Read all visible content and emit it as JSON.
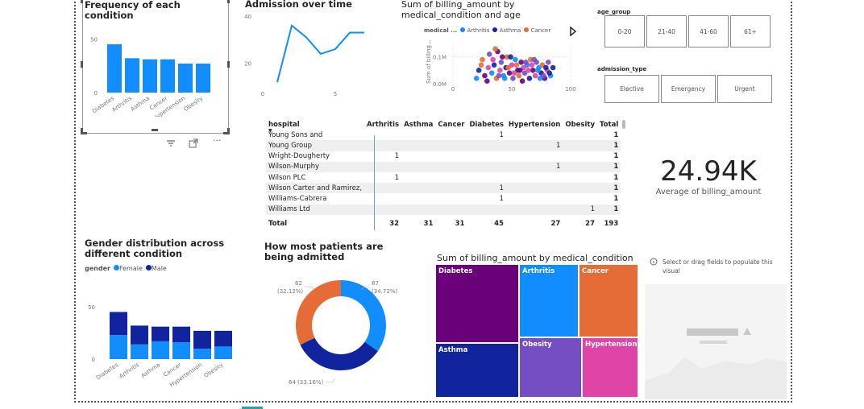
{
  "freq_chart": {
    "title": "Frequency of each condition",
    "chart_data": {
      "type": "bar",
      "categories": [
        "Diabetes",
        "Arthritis",
        "Asthma",
        "Cancer",
        "Hypertension",
        "Obesity"
      ],
      "values": [
        45,
        32,
        31,
        31,
        27,
        27
      ],
      "ylim": [
        0,
        60
      ],
      "yticks": [
        "0",
        "50"
      ],
      "color": "#118DFF"
    },
    "toolbar": {
      "filter_icon": "filter-icon",
      "focus_icon": "focus-mode-icon",
      "more_icon": "more-options-icon"
    }
  },
  "admission_chart": {
    "title": "Admission over time",
    "chart_data": {
      "type": "line",
      "x": [
        1,
        2,
        3,
        4,
        5,
        6,
        7
      ],
      "y": [
        12,
        36,
        31,
        24,
        26,
        33,
        33
      ],
      "xlim": [
        0,
        8
      ],
      "ylim": [
        10,
        40
      ],
      "xticks": [
        "0",
        "5"
      ],
      "yticks": [
        "20",
        "40"
      ],
      "color": "#118DFF"
    }
  },
  "scatter_chart": {
    "title": "Sum of billing_amount by medical_condition and age",
    "legend_label": "medical ...",
    "legend": [
      {
        "name": "Arthritis",
        "color": "#118DFF"
      },
      {
        "name": "Asthma",
        "color": "#12239E"
      },
      {
        "name": "Cancer",
        "color": "#E66C37"
      }
    ],
    "ylabel": "Sum of billing...",
    "yticks": [
      "0.0M",
      "0.1M"
    ],
    "xticks": [
      "0",
      "50",
      "100"
    ],
    "chart_data": {
      "type": "scatter",
      "xlim": [
        0,
        100
      ],
      "ylim": [
        0,
        0.15
      ],
      "series_colors": [
        "#118DFF",
        "#12239E",
        "#E66C37",
        "#6B007B",
        "#E044A7",
        "#744EC2"
      ],
      "points": [
        [
          20,
          0.02
        ],
        [
          22,
          0.05
        ],
        [
          25,
          0.09
        ],
        [
          27,
          0.03
        ],
        [
          30,
          0.06
        ],
        [
          31,
          0.11
        ],
        [
          33,
          0.04
        ],
        [
          35,
          0.07
        ],
        [
          37,
          0.02
        ],
        [
          38,
          0.12
        ],
        [
          40,
          0.05
        ],
        [
          41,
          0.08
        ],
        [
          43,
          0.03
        ],
        [
          45,
          0.06
        ],
        [
          46,
          0.1
        ],
        [
          48,
          0.04
        ],
        [
          50,
          0.07
        ],
        [
          51,
          0.02
        ],
        [
          53,
          0.09
        ],
        [
          55,
          0.05
        ],
        [
          56,
          0.03
        ],
        [
          58,
          0.08
        ],
        [
          60,
          0.06
        ],
        [
          61,
          0.04
        ],
        [
          63,
          0.07
        ],
        [
          65,
          0.02
        ],
        [
          66,
          0.09
        ],
        [
          68,
          0.05
        ],
        [
          70,
          0.03
        ],
        [
          71,
          0.08
        ],
        [
          73,
          0.06
        ],
        [
          75,
          0.04
        ],
        [
          76,
          0.07
        ],
        [
          78,
          0.02
        ],
        [
          80,
          0.05
        ],
        [
          81,
          0.08
        ],
        [
          83,
          0.03
        ],
        [
          85,
          0.06
        ],
        [
          24,
          0.07
        ],
        [
          29,
          0.01
        ],
        [
          34,
          0.09
        ],
        [
          39,
          0.03
        ],
        [
          44,
          0.02
        ],
        [
          49,
          0.1
        ],
        [
          54,
          0.07
        ],
        [
          59,
          0.01
        ],
        [
          64,
          0.05
        ],
        [
          69,
          0.09
        ],
        [
          74,
          0.02
        ],
        [
          79,
          0.06
        ],
        [
          36,
          0.13
        ],
        [
          42,
          0.1
        ],
        [
          52,
          0.04
        ],
        [
          62,
          0.08
        ],
        [
          72,
          0.05
        ],
        [
          82,
          0.04
        ],
        [
          47,
          0.06
        ],
        [
          57,
          0.05
        ],
        [
          67,
          0.07
        ],
        [
          77,
          0.03
        ]
      ]
    },
    "play_icon": "play-icon"
  },
  "slicers": {
    "age_group": {
      "title": "age_group",
      "options": [
        "0-20",
        "21-40",
        "41-60",
        "61+"
      ]
    },
    "admission_type": {
      "title": "admission_type",
      "options": [
        "Elective",
        "Emergency",
        "Urgent"
      ]
    }
  },
  "matrix": {
    "headers": [
      "hospital",
      "Arthritis",
      "Asthma",
      "Cancer",
      "Diabetes",
      "Hypertension",
      "Obesity",
      "Total"
    ],
    "rows": [
      [
        "Young Sons and",
        "",
        "",
        "",
        "1",
        "",
        "",
        "1"
      ],
      [
        "Young Group",
        "",
        "",
        "",
        "",
        "1",
        "",
        "1"
      ],
      [
        "Wright-Dougherty",
        "1",
        "",
        "",
        "",
        "",
        "",
        "1"
      ],
      [
        "Wilson-Murphy",
        "",
        "",
        "",
        "",
        "1",
        "",
        "1"
      ],
      [
        "Wilson PLC",
        "1",
        "",
        "",
        "",
        "",
        "",
        "1"
      ],
      [
        "Wilson Carter and Ramirez,",
        "",
        "",
        "",
        "1",
        "",
        "",
        "1"
      ],
      [
        "Williams-Cabrera",
        "",
        "",
        "",
        "1",
        "",
        "",
        "1"
      ],
      [
        "Williams Ltd",
        "",
        "",
        "",
        "",
        "",
        "1",
        "1"
      ]
    ],
    "total": [
      "Total",
      "32",
      "31",
      "31",
      "45",
      "27",
      "27",
      "193"
    ]
  },
  "card": {
    "value": "24.94K",
    "label": "Average of billing_amount"
  },
  "gender_chart": {
    "title": "Gender distribution across different condition",
    "legend_label": "gender",
    "legend": [
      {
        "name": "Female",
        "color": "#118DFF"
      },
      {
        "name": "Male",
        "color": "#12239E"
      }
    ],
    "chart_data": {
      "type": "bar",
      "stacked": true,
      "categories": [
        "Diabetes",
        "Arthritis",
        "Asthma",
        "Cancer",
        "Hypertension",
        "Obesity"
      ],
      "series": [
        {
          "name": "Female",
          "values": [
            23,
            14,
            17,
            16,
            10,
            12
          ]
        },
        {
          "name": "Male",
          "values": [
            22,
            18,
            14,
            15,
            17,
            15
          ]
        }
      ],
      "ylim": [
        0,
        60
      ],
      "yticks": [
        "0",
        "50"
      ]
    }
  },
  "donut_chart": {
    "title": "How most patients are being admitted",
    "chart_data": {
      "type": "pie",
      "slices": [
        {
          "value": 67,
          "label": "67",
          "pct": "(34.72%)",
          "color": "#118DFF"
        },
        {
          "value": 64,
          "label": "64 (33.16%)",
          "pct": "",
          "color": "#12239E"
        },
        {
          "value": 62,
          "label": "62",
          "pct": "(32.12%)",
          "color": "#E66C37"
        }
      ]
    }
  },
  "treemap": {
    "title": "Sum of billing_amount by medical_condition",
    "chart_data": {
      "type": "treemap",
      "cells": [
        {
          "name": "Diabetes",
          "color": "#6B007B"
        },
        {
          "name": "Arthritis",
          "color": "#118DFF"
        },
        {
          "name": "Cancer",
          "color": "#E66C37"
        },
        {
          "name": "Asthma",
          "color": "#12239E"
        },
        {
          "name": "Obesity",
          "color": "#744EC2"
        },
        {
          "name": "Hypertension",
          "color": "#E044A7"
        }
      ]
    }
  },
  "placeholder": {
    "icon": "info-icon",
    "text": "Select or drag fields to populate this visual"
  }
}
